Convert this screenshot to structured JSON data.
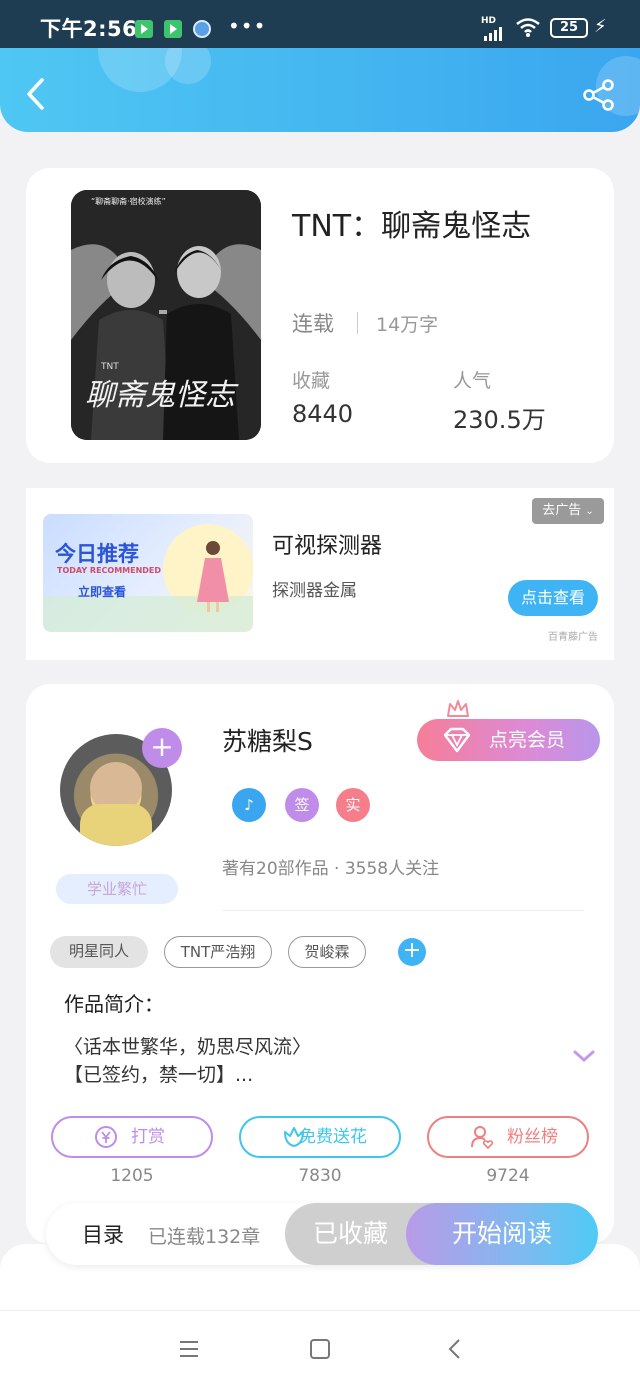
{
  "status_bar": {
    "time": "下午2:56",
    "network": "HD",
    "battery": "25",
    "more": "•••"
  },
  "header": {
    "back_icon": "chevron-left-icon",
    "share_icon": "share-icon"
  },
  "book": {
    "title": "TNT：聊斋鬼怪志",
    "status": "连载",
    "word_count": "14万字",
    "favorites_label": "收藏",
    "favorites_value": "8440",
    "popularity_label": "人气",
    "popularity_value": "230.5万",
    "cover": {
      "top_caption": "“聊斋聊斋·宿校演练”",
      "series": "TNT",
      "title_art": "聊斋鬼怪志"
    }
  },
  "ad": {
    "banner_title": "今日推荐",
    "banner_subtitle": "TODAY RECOMMENDED",
    "banner_button": "立即查看",
    "title": "可视探测器",
    "description": "探测器金属",
    "close_label": "去广告",
    "cta_label": "点击查看",
    "source": "百青藤广告"
  },
  "author": {
    "name": "苏糖梨S",
    "status_tag": "学业繁忙",
    "vip_button": "点亮会员",
    "badges": [
      {
        "label": "",
        "icon": "music-note-icon",
        "color": "#3aa6ef"
      },
      {
        "label": "签",
        "color": "#c08cea"
      },
      {
        "label": "实",
        "color": "#f57e8a"
      }
    ],
    "works_info": "著有20部作品 · 3558人关注"
  },
  "tags": [
    "明星同人",
    "TNT严浩翔",
    "贺峻霖"
  ],
  "intro": {
    "label": "作品简介：",
    "line1": "〈话本世繁华，奶思尽风流〉",
    "line2": "【已签约，禁一切】..."
  },
  "actions": [
    {
      "label": "打赏",
      "count": "1205",
      "icon": "yen-coin-icon",
      "color": "#c08cea"
    },
    {
      "label": "免费送花",
      "count": "7830",
      "icon": "flower-icon",
      "color": "#3fc6e8"
    },
    {
      "label": "粉丝榜",
      "count": "9724",
      "icon": "fan-heart-icon",
      "color": "#f08080"
    }
  ],
  "bottom_bar": {
    "toc_label": "目录",
    "toc_count": "已连载132章",
    "collected_label": "已收藏",
    "read_label": "开始阅读"
  }
}
